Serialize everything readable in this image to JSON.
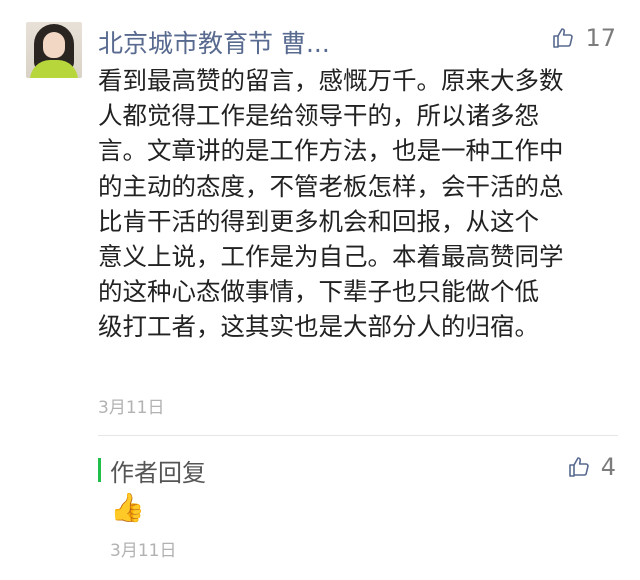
{
  "comment": {
    "author": "北京城市教育节 曹...",
    "likes": "17",
    "lines": [
      "看到最高赞的留言，感慨万千。原来大多数",
      "人都觉得工作是给领导干的，所以诸多怨",
      "言。文章讲的是工作方法，也是一种工作中",
      "的主动的态度，不管老板怎样，会干活的总",
      "比肯干活的得到更多机会和回报，从这个",
      "意义上说，工作是为自己。本着最高赞同学",
      "的这种心态做事情，下辈子也只能做个低",
      "级打工者，这其实也是大部分人的归宿。"
    ],
    "date": "3月11日"
  },
  "reply": {
    "label": "作者回复",
    "likes": "4",
    "content": "👍",
    "date": "3月11日"
  },
  "colors": {
    "author_name": "#586a8f",
    "reply_accent": "#1fbf4a",
    "muted": "#b2b2b2"
  },
  "icons": {
    "like": "thumbs-up-outline-icon",
    "emoji": "thumbs-up-emoji-icon"
  }
}
